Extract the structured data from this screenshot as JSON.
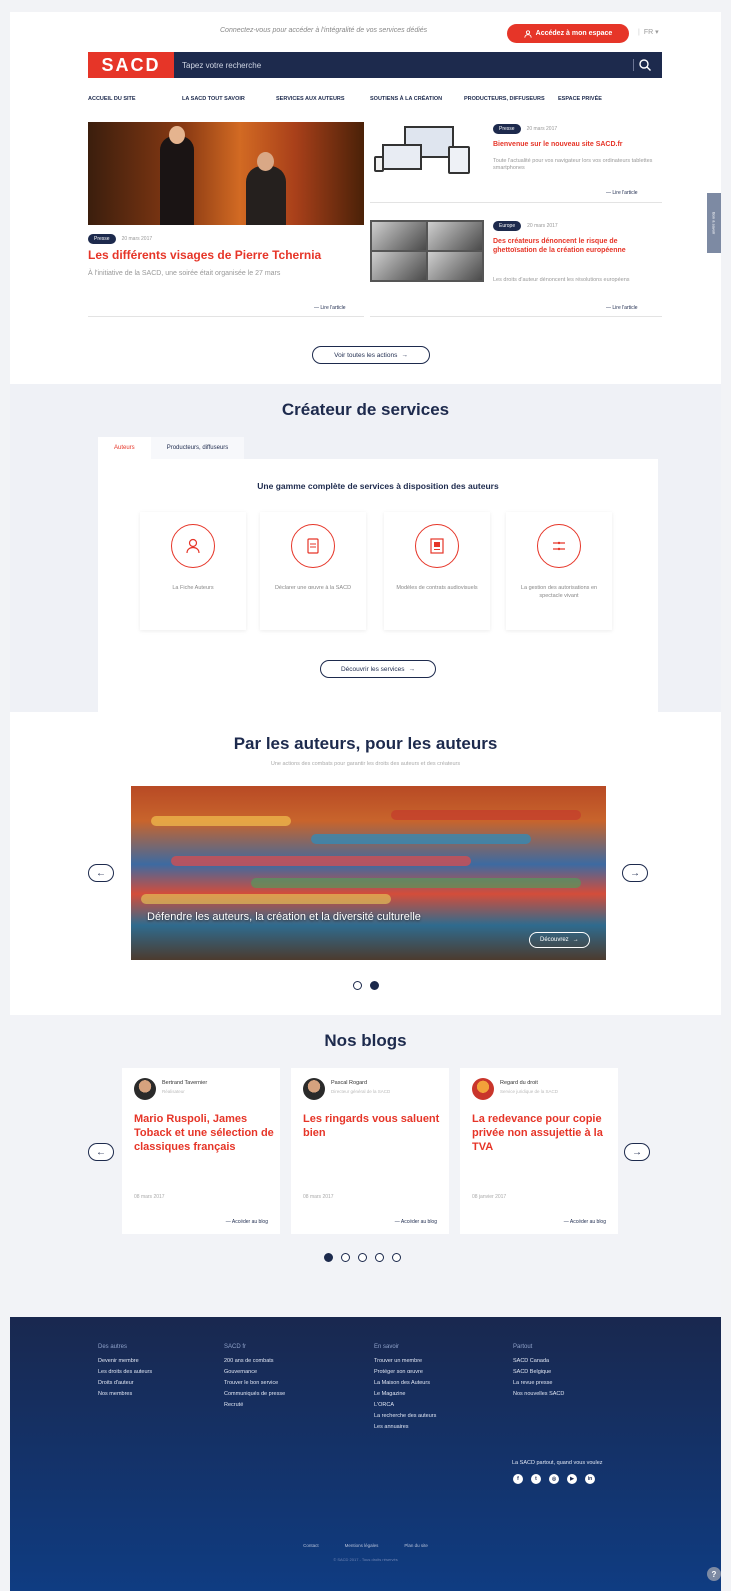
{
  "topbar": {
    "message": "Connectez-vous pour accéder à l'intégralité de vos services dédiés",
    "login_label": "Accédez à mon espace",
    "lang": "FR"
  },
  "header": {
    "logo": "SACD",
    "search_placeholder": "Tapez votre recherche"
  },
  "nav": [
    "Accueil du site",
    "La SACD tout savoir",
    "Services aux auteurs",
    "Soutiens à la création",
    "Producteurs, diffuseurs",
    "Espace privée"
  ],
  "featured": {
    "badge": "Presse",
    "date": "20 mars 2017",
    "title": "Les différents visages de Pierre Tchernia",
    "summary": "À l'initiative de la SACD, une soirée était organisée le 27 mars",
    "read_more": "Lire l'article"
  },
  "side_articles": [
    {
      "badge": "Presse",
      "date": "20 mars 2017",
      "title": "Bienvenue sur le nouveau site SACD.fr",
      "summary": "Toute l'actualité pour vos navigateur lors vos ordinateurs tablettes smartphones",
      "read_more": "Lire l'article"
    },
    {
      "badge": "Europe",
      "date": "20 mars 2017",
      "title": "Des créateurs dénoncent le risque de ghettoïsation de la création européenne",
      "summary": "Les droits d'auteur dénoncent les résolutions européens",
      "read_more": "Lire l'article"
    }
  ],
  "all_news_button": "Voir toutes les actions",
  "services": {
    "title": "Créateur de services",
    "tabs": [
      "Auteurs",
      "Producteurs, diffuseurs"
    ],
    "subtitle": "Une gamme complète de services à disposition des auteurs",
    "cards": [
      {
        "label": "La Fiche Auteurs",
        "icon": "author-profile-icon"
      },
      {
        "label": "Déclarer une œuvre à la SACD",
        "icon": "document-declare-icon"
      },
      {
        "label": "Modèles de contrats audiovisuels",
        "icon": "contract-icon"
      },
      {
        "label": "La gestion des autorisations en spectacle vivant",
        "icon": "authorization-icon"
      }
    ],
    "discover_button": "Découvrir les services"
  },
  "auteurs": {
    "title": "Par les auteurs, pour les auteurs",
    "subtitle": "Une actions des combats pour garantir les droits des auteurs et des créateurs",
    "slide_text": "Défendre les auteurs, la création et la diversité culturelle",
    "slide_button": "Découvrez"
  },
  "blogs": {
    "title": "Nos blogs",
    "cards": [
      {
        "author": "Bertrand Tavernier",
        "role": "Réalisateur",
        "title": "Mario Ruspoli, James Toback et une sélection de classiques français",
        "date": "08 mars 2017",
        "link": "Accéder au blog"
      },
      {
        "author": "Pascal Rogard",
        "role": "Directeur général de la SACD",
        "title": "Les ringards vous saluent bien",
        "date": "08 mars 2017",
        "link": "Accéder au blog"
      },
      {
        "author": "Regard du droit",
        "role": "Service juridique de la SACD",
        "title": "La redevance pour copie privée non assujettie à la TVA",
        "date": "08 janvier 2017",
        "link": "Accéder au blog"
      }
    ]
  },
  "footer": {
    "columns": [
      {
        "heading": "Des autres",
        "links": [
          "Devenir membre",
          "Les droits des auteurs",
          "Droits d'auteur",
          "Nos membres"
        ]
      },
      {
        "heading": "SACD fr",
        "links": [
          "200 ans de combats",
          "Gouvernance",
          "Trouver le bon service",
          "Communiqués de presse",
          "Recruté"
        ]
      },
      {
        "heading": "En savoir",
        "links": [
          "Trouver un membre",
          "Protéger son œuvre",
          "La Maison des Auteurs",
          "Le Magazine",
          "L'ORCA",
          "La recherche des auteurs",
          "Les annuaires"
        ]
      },
      {
        "heading": "Partout",
        "links": [
          "SACD Canada",
          "SACD Belgique",
          "La revue presse",
          "Nos nouvelles SACD"
        ]
      }
    ],
    "social_label": "La SACD partout, quand vous voulez",
    "socials": [
      "facebook-icon",
      "twitter-icon",
      "instagram-icon",
      "youtube-icon",
      "linkedin-icon"
    ],
    "legal": [
      "Contact",
      "Mentions légales",
      "Plan du site"
    ],
    "copyright": "© SACD 2017 - Tous droits réservés"
  },
  "side_tab": "Bon à savoir",
  "colors": {
    "navy": "#1d2a4d",
    "red": "#e63528",
    "footer_top": "#19284f",
    "footer_bottom": "#0f3c82"
  }
}
